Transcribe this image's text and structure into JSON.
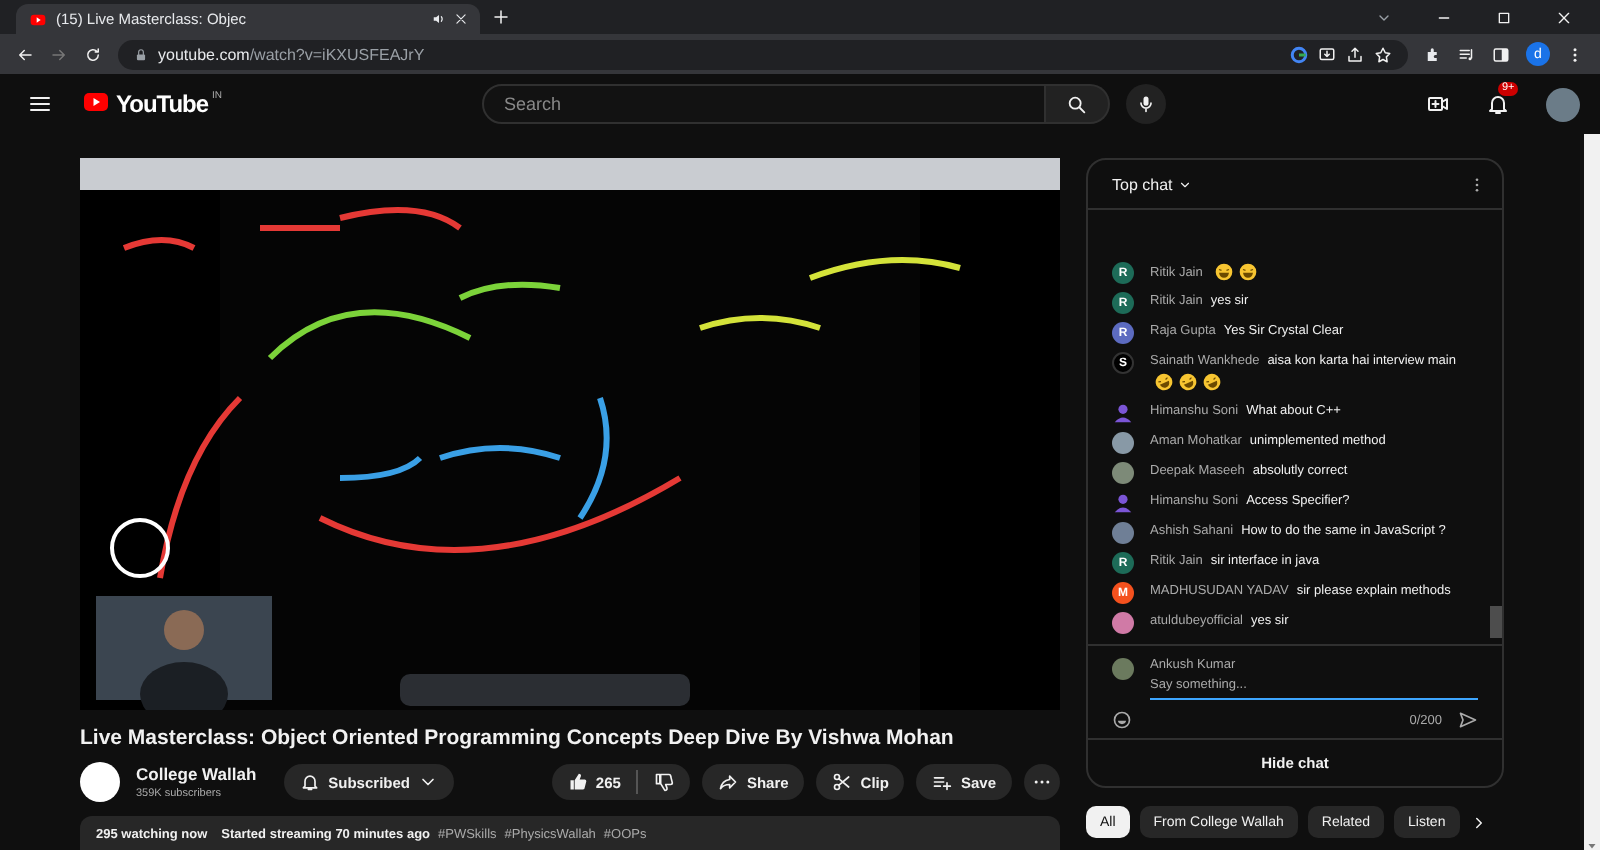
{
  "browser": {
    "tab": {
      "title": "(15) Live Masterclass: Objec"
    },
    "url_host": "youtube.com",
    "url_path": "/watch?v=iKXUSFEAJrY",
    "profile_letter": "d"
  },
  "header": {
    "logo_text": "YouTube",
    "country": "IN",
    "search": {
      "placeholder": "Search"
    },
    "notifications_badge": "9+"
  },
  "title": "Live Masterclass: Object Oriented Programming Concepts Deep Dive By Vishwa Mohan",
  "channel": {
    "name": "College Wallah",
    "subscribers": "359K subscribers"
  },
  "actions": {
    "subscribe": "Subscribed",
    "likes": "265",
    "share": "Share",
    "clip": "Clip",
    "save": "Save"
  },
  "description": {
    "watching": "295 watching now",
    "started": "Started streaming 70 minutes ago",
    "hashtags": [
      "#PWSkills",
      "#PhysicsWallah",
      "#OOPs"
    ]
  },
  "chat": {
    "title": "Top chat",
    "messages": [
      {
        "author": "Ritik Jain",
        "emojis": [
          {
            "kind": "grin"
          },
          {
            "kind": "grin"
          }
        ],
        "avatar": {
          "kind": "letter",
          "letter": "R",
          "color": "#1d6b58"
        }
      },
      {
        "author": "Ritik Jain",
        "text": "yes sir",
        "avatar": {
          "kind": "letter",
          "letter": "R",
          "color": "#1d6b58"
        }
      },
      {
        "author": "Raja Gupta",
        "text": "Yes Sir Crystal Clear",
        "avatar": {
          "kind": "letter",
          "letter": "R",
          "color": "#5c6bc0"
        }
      },
      {
        "author": "Sainath Wankhede",
        "text": "aisa kon karta hai interview main",
        "emojis": [
          {
            "kind": "rofl"
          },
          {
            "kind": "rofl"
          },
          {
            "kind": "rofl"
          }
        ],
        "avatar": {
          "kind": "letter",
          "letter": "S",
          "color": "#000000"
        }
      },
      {
        "author": "Himanshu Soni",
        "text": "What about C++",
        "avatar": {
          "kind": "icon",
          "color": "#7b55d6"
        }
      },
      {
        "author": "Aman Mohatkar",
        "text": "unimplemented method"
      },
      {
        "author": "Deepak Maseeh",
        "text": "absolutly correct"
      },
      {
        "author": "Himanshu Soni",
        "text": "Access Specifier?",
        "avatar": {
          "kind": "icon",
          "color": "#7b55d6"
        }
      },
      {
        "author": "Ashish Sahani",
        "text": "How to do the same in JavaScript ?"
      },
      {
        "author": "Ritik Jain",
        "text": "sir interface in java",
        "avatar": {
          "kind": "letter",
          "letter": "R",
          "color": "#1d6b58"
        }
      },
      {
        "author": "MADHUSUDAN YADAV",
        "text": "sir please explain methods",
        "avatar": {
          "kind": "letter",
          "letter": "M",
          "color": "#f4511e"
        }
      },
      {
        "author": "atuldubeyofficial",
        "text": "yes sir"
      }
    ],
    "composer": {
      "author": "Ankush Kumar",
      "placeholder": "Say something...",
      "count": "0/200"
    },
    "hide": "Hide chat"
  },
  "chips": [
    {
      "label": "All",
      "selected": true
    },
    {
      "label": "From College Wallah",
      "selected": false
    },
    {
      "label": "Related",
      "selected": false
    },
    {
      "label": "Listen",
      "selected": false
    }
  ]
}
